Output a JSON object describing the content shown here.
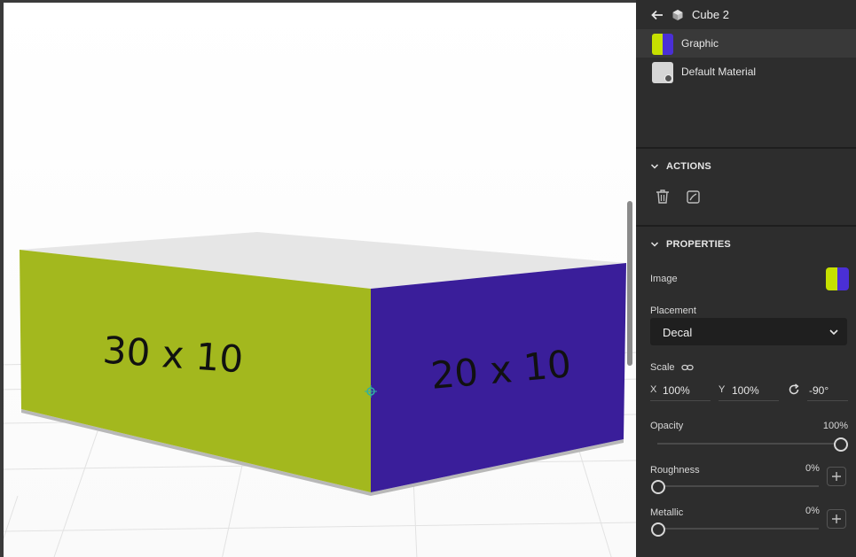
{
  "viewport": {
    "box_labels": {
      "left_face": "30 x 10",
      "right_face": "20 x 10"
    },
    "colors": {
      "left_face": "#a3b81e",
      "right_face": "#3a1e9a",
      "top_face": "#e6e6e6"
    }
  },
  "panel": {
    "header": {
      "title": "Cube 2",
      "back_icon": "arrow-left-icon",
      "object_icon": "cube-icon"
    },
    "layers": [
      {
        "label": "Graphic",
        "selected": true,
        "thumb_colors": [
          "#c6e000",
          "#4a2fd6"
        ]
      },
      {
        "label": "Default Material",
        "selected": false,
        "thumb_colors": [
          "#d8d8d8"
        ]
      }
    ],
    "actions": {
      "title": "ACTIONS",
      "buttons": [
        {
          "icon": "trash-icon"
        },
        {
          "icon": "edit-material-icon"
        }
      ]
    },
    "properties": {
      "title": "PROPERTIES",
      "image_label": "Image",
      "placement_label": "Placement",
      "placement_value": "Decal",
      "scale_label": "Scale",
      "scale_x_label": "X",
      "scale_x_value": "100%",
      "scale_y_label": "Y",
      "scale_y_value": "100%",
      "rotation_value": "-90°",
      "opacity_label": "Opacity",
      "opacity_value": "100%",
      "opacity_level": 1.0,
      "roughness_label": "Roughness",
      "roughness_value": "0%",
      "roughness_level": 0,
      "metallic_label": "Metallic",
      "metallic_value": "0%",
      "metallic_level": 0
    }
  }
}
